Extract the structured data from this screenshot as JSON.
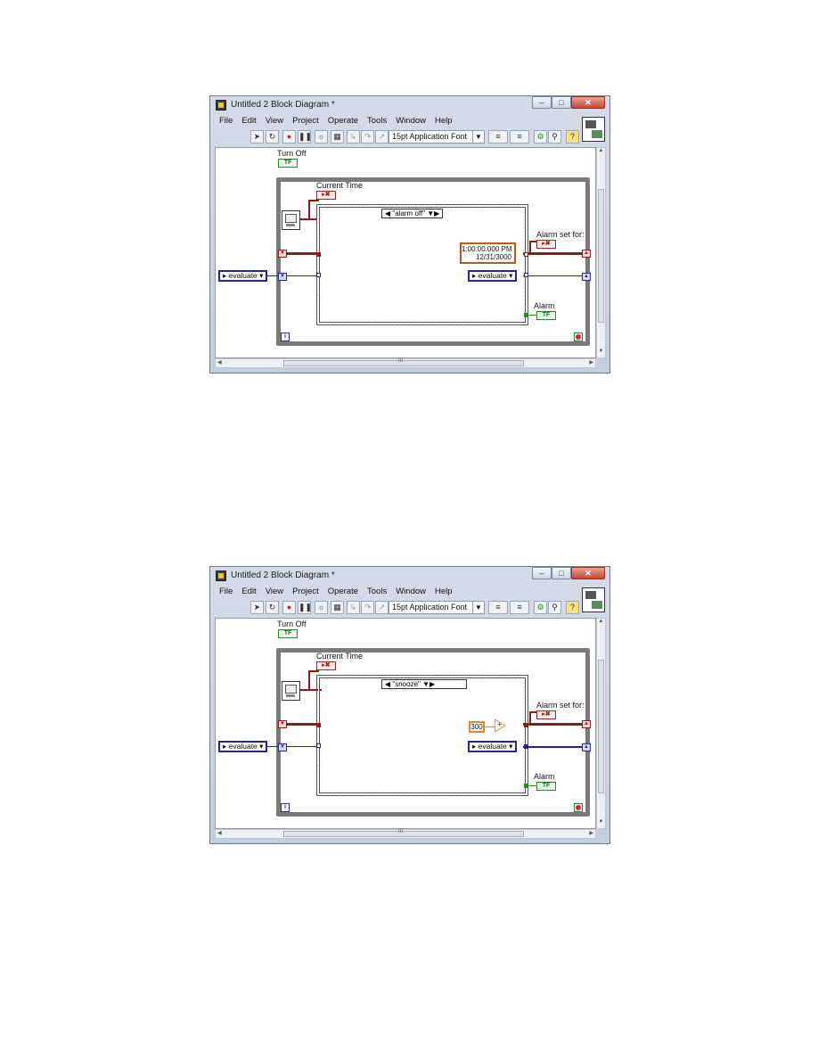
{
  "windows": [
    {
      "title": "Untitled 2 Block Diagram *",
      "menu": [
        "File",
        "Edit",
        "View",
        "Project",
        "Operate",
        "Tools",
        "Window",
        "Help"
      ],
      "font": "15pt Application Font",
      "labels": {
        "turn_off": "Turn Off",
        "current_time": "Current Time",
        "alarm_set_for": "Alarm set for:",
        "alarm": "Alarm"
      },
      "case_selector": "\"alarm off\"",
      "enum_left": "evaluate",
      "enum_inner": "evaluate",
      "time_constant_line1": "1:00:00.000 PM",
      "time_constant_line2": "12/31/3000"
    },
    {
      "title": "Untitled 2 Block Diagram *",
      "menu": [
        "File",
        "Edit",
        "View",
        "Project",
        "Operate",
        "Tools",
        "Window",
        "Help"
      ],
      "font": "15pt Application Font",
      "labels": {
        "turn_off": "Turn Off",
        "current_time": "Current Time",
        "alarm_set_for": "Alarm set for:",
        "alarm": "Alarm"
      },
      "case_selector": "\"snooze\"",
      "enum_left": "evaluate",
      "enum_inner": "evaluate",
      "numeric_constant": "300",
      "add_symbol": "+"
    }
  ],
  "colors": {
    "boolean": "#2a8a2a",
    "timestamp": "#8b1a1a",
    "enum": "#23239a",
    "numeric": "#e08a2a"
  },
  "icons": [
    "labview-app-icon",
    "run-arrow-icon",
    "abort-icon",
    "pause-icon",
    "highlight-execution-icon",
    "vi-icon"
  ]
}
